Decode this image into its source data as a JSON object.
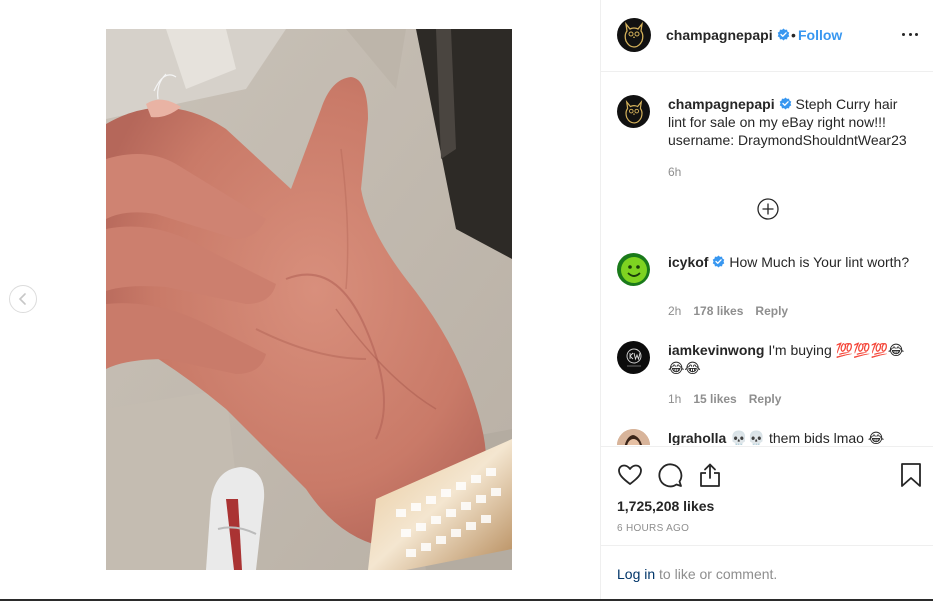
{
  "header": {
    "username": "champagnepapi",
    "dot": "•",
    "follow_label": "Follow"
  },
  "caption": {
    "username": "champagnepapi",
    "text": "Steph Curry hair lint for sale on my eBay right now!!! username: DraymondShouldntWear23",
    "time": "6h"
  },
  "comments": [
    {
      "username": "icykof",
      "text": "How Much is Your lint worth?",
      "time": "2h",
      "likes": "178 likes",
      "reply": "Reply",
      "verified": true
    },
    {
      "username": "iamkevinwong",
      "text": "I'm buying 💯💯💯😂😂😂",
      "time": "1h",
      "likes": "15 likes",
      "reply": "Reply",
      "verified": false
    },
    {
      "username": "lgraholla",
      "text": "💀💀 them bids lmao 😂",
      "time": "",
      "likes": "",
      "reply": "",
      "verified": false
    }
  ],
  "likes_count": "1,725,208 likes",
  "time_ago": "6 HOURS AGO",
  "login": {
    "link": "Log in",
    "rest": " to like or comment."
  },
  "colors": {
    "link_blue": "#3897f0",
    "verified_blue": "#3897f0",
    "muted": "#8e8e8e",
    "text": "#262626",
    "login_link": "#003569"
  },
  "icons": [
    "chevron-left-icon",
    "owl-logo-icon",
    "verified-badge-icon",
    "more-options-icon",
    "load-more-comments-icon",
    "heart-icon",
    "comment-icon",
    "share-icon",
    "bookmark-icon"
  ]
}
